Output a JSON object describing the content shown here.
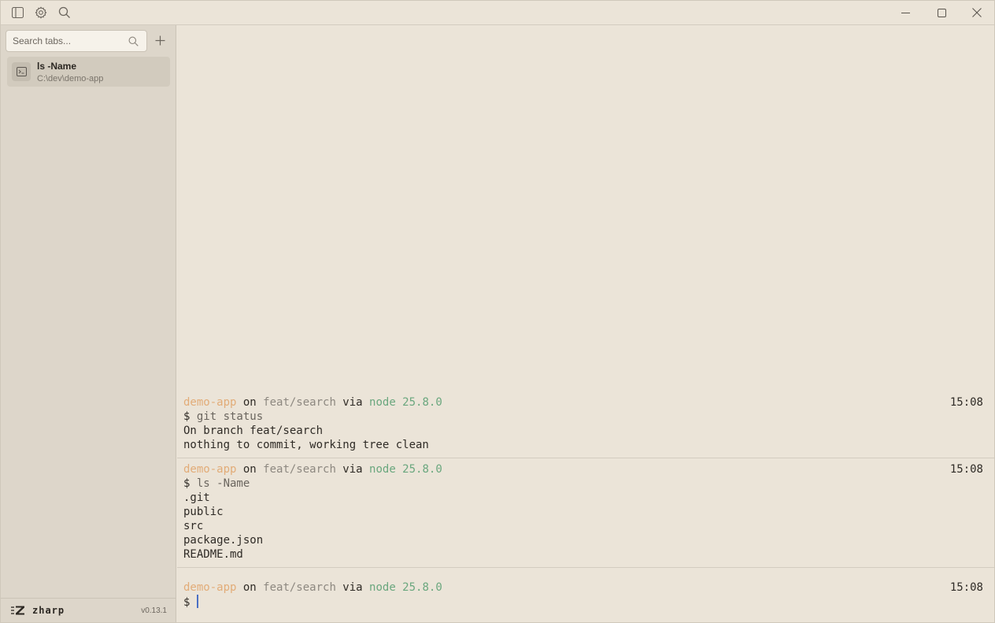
{
  "search": {
    "placeholder": "Search tabs..."
  },
  "tabs": [
    {
      "title": "ls -Name",
      "path": "C:\\dev\\demo-app"
    }
  ],
  "footer": {
    "app_name": "zharp",
    "version": "v0.13.1"
  },
  "prompt": {
    "dir": "demo-app",
    "on": " on ",
    "branch": "feat/search",
    "via": " via ",
    "node": "node 25.8.0",
    "symbol": "$ "
  },
  "blocks": [
    {
      "time": "15:08",
      "command": "git status",
      "output": [
        "On branch feat/search",
        "nothing to commit, working tree clean"
      ]
    },
    {
      "time": "15:08",
      "command": "ls -Name",
      "output": [
        ".git",
        "public",
        "src",
        "package.json",
        "README.md"
      ]
    }
  ],
  "current": {
    "time": "15:08"
  },
  "colors": {
    "background": "#ebe4d8",
    "sidebar": "#ddd6ca",
    "prompt_dir": "#e2ac78",
    "prompt_branch": "#8d8880",
    "prompt_node": "#6aa77e",
    "cursor": "#4a6fc4"
  },
  "icons": [
    "sidebar-toggle-icon",
    "settings-icon",
    "search-icon",
    "minimize-icon",
    "maximize-icon",
    "close-icon",
    "plus-icon",
    "terminal-icon",
    "logo-icon"
  ]
}
